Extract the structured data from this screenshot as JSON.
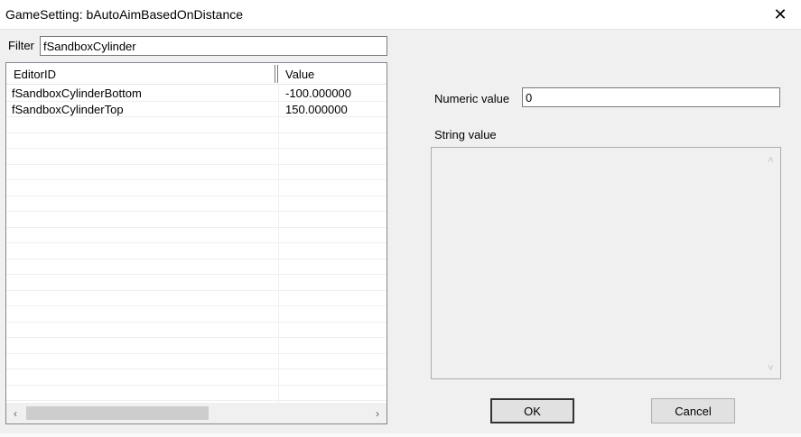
{
  "window": {
    "title": "GameSetting: bAutoAimBasedOnDistance",
    "close_glyph": "✕"
  },
  "filter": {
    "label": "Filter",
    "value": "fSandboxCylinder"
  },
  "list": {
    "columns": [
      "EditorID",
      "Value"
    ],
    "rows": [
      {
        "editor_id": "fSandboxCylinderBottom",
        "value": "-100.000000"
      },
      {
        "editor_id": "fSandboxCylinderTop",
        "value": "150.000000"
      }
    ],
    "scroll_left_glyph": "‹",
    "scroll_right_glyph": "›"
  },
  "numeric": {
    "label": "Numeric value",
    "value": "0"
  },
  "string_value": {
    "label": "String value",
    "value": "",
    "scroll_up_glyph": "˄",
    "scroll_down_glyph": "˅"
  },
  "buttons": {
    "ok_label": "OK",
    "cancel_label": "Cancel"
  }
}
